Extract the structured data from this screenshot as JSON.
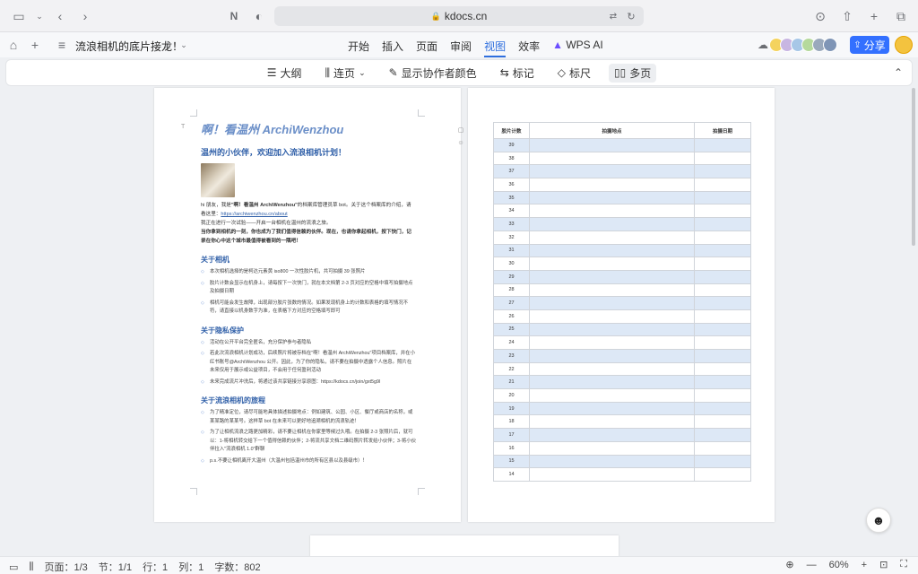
{
  "browser": {
    "url": "kdocs.cn",
    "icons": [
      "sidebar-icon",
      "chevron-down-icon",
      "back-icon",
      "forward-icon",
      "notion-icon",
      "shield-icon",
      "lock-icon",
      "translate-icon",
      "reload-icon",
      "download-icon",
      "share-icon",
      "plus-icon",
      "tabs-icon"
    ]
  },
  "app": {
    "doc_title": "流浪相机的底片接龙！",
    "menu": [
      "开始",
      "插入",
      "页面",
      "审阅",
      "视图",
      "效率",
      "WPS AI"
    ],
    "active_menu": "视图",
    "share_label": "分享"
  },
  "toolbar": {
    "items": [
      "大纲",
      "连页",
      "显示协作者颜色",
      "标记",
      "标尺",
      "多页"
    ]
  },
  "left_page": {
    "title": "啊！看温州 ArchiWenzhou",
    "subtitle": "温州的小伙伴，欢迎加入流浪相机计划！",
    "intro_1a": "hi 朋友，我是",
    "intro_1b": "\"啊！看温州 ArchiWenzhou\"",
    "intro_1c": "的档案库管理员草 bot。关于这个档案库的介绍，请看这里：",
    "intro_link": "https://archiwenzhou.cn/about",
    "intro_2": "我正在进行一次试验——开启一台相机在温州的流浪之旅。",
    "intro_3": "当你拿到相机的一刻，你也成为了我们值得信赖的伙伴。现在，也请你拿起相机，按下快门，记录在你心中这个城市最值得被看到的一隅吧！",
    "sections": [
      {
        "heading": "关于相机",
        "bullets": [
          "本次相机选择的是柯达元素黄 iso800 一次性胶片机，共可拍摄 39 张照片",
          "胶片计数会显示在机身上，请每按下一次快门，就在本文档第 2-3 页对应的空格中填写拍摄地点及拍摄日期",
          "相机可能会发生故障，出现部分胶片张数的情况。如果发现机身上的计数和表格的填写情况不符，请直接以机身数字为准，在表格下方对应的空格填写即可"
        ]
      },
      {
        "heading": "关于隐私保护",
        "bullets": [
          "活动在公开平台完全匿名，充分保护参与者隐私",
          "若此次流浪相机计划成功，后续照片将被存档在\"啊！看温州 ArchiWenzhou\"项目档案库，并在小红书账号@ArchiWenzhou 公开。因此，为了你的隐私，请不要在拍摄中透露个人信息。照片在未来仅用于展示或公益项目，不会用于任何盈利活动",
          "未来完成流片冲洗后，将通过该共享链接分享原图：https://kdocs.cn/join/gxt5g9l"
        ]
      },
      {
        "heading": "关于流浪相机的旅程",
        "bullets": [
          "为了精准定位，请尽可能地具体描述拍摄地点：例如建筑、公园、小区、餐厅或商店的名称，或某某路的某某号。这样草 bot 在未来可以更好地追溯相机的流浪轨迹！",
          "为了让相机流浪之路更加精彩，请不要让相机在你家里等候过久哦。在拍摄 2-3 张照片后，就可以：1-将相机转交给下一个值得信赖的伙伴；2-将流共享文档二维码照片转发给小伙伴；3-将小伙伴拉入\"流浪相机 1.0\"群聊",
          "p.s.不要让相机离开大温州（大温州包括温州市的所有区县以及县级市）！"
        ]
      }
    ]
  },
  "right_page": {
    "columns": [
      "胶片计数",
      "拍摄地点",
      "拍摄日期"
    ],
    "rows": [
      39,
      38,
      37,
      36,
      35,
      34,
      33,
      32,
      31,
      30,
      29,
      28,
      27,
      26,
      25,
      24,
      23,
      22,
      21,
      20,
      19,
      18,
      17,
      16,
      15,
      14
    ]
  },
  "status": {
    "page": "页面：1/3",
    "section": "节：1/1",
    "row": "行：1",
    "col": "列：1",
    "words": "字数：802",
    "zoom": "60%"
  }
}
